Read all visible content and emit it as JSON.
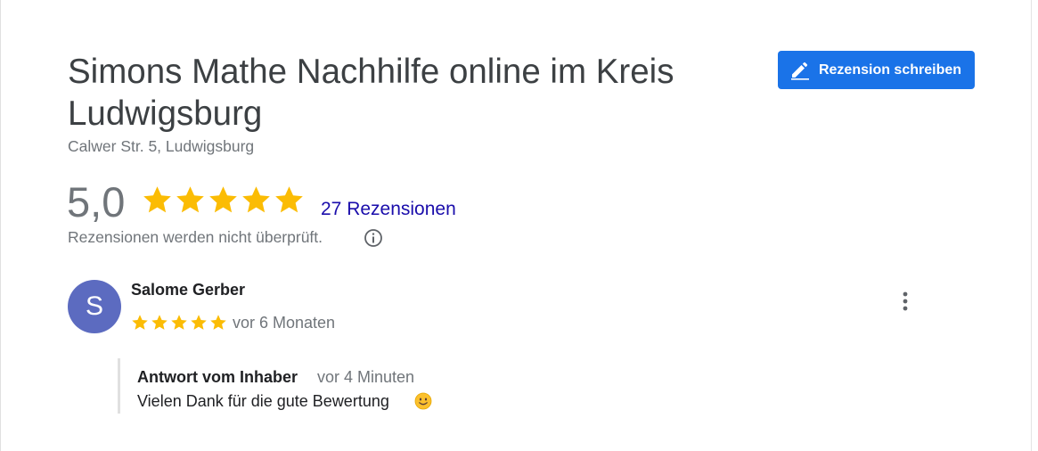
{
  "header": {
    "title": "Simons Mathe Nachhilfe online im Kreis Ludwigsburg",
    "address": "Calwer Str. 5, Ludwigsburg",
    "write_review_label": "Rezension schreiben"
  },
  "rating": {
    "value": "5,0",
    "stars": 5,
    "review_count_label": "27 Rezensionen",
    "disclaimer": "Rezensionen werden nicht überprüft."
  },
  "review": {
    "avatar_letter": "S",
    "author": "Salome Gerber",
    "stars": 5,
    "date": "vor 6 Monaten",
    "owner_reply": {
      "label": "Antwort vom Inhaber",
      "time": "vor 4 Minuten",
      "text": "Vielen Dank für die gute Bewertung"
    }
  },
  "icons": {
    "write": "pencil-icon",
    "info": "info-icon",
    "more": "more-vertical-icon",
    "emoji": "smiley-icon"
  },
  "colors": {
    "accent": "#1a73e8",
    "star": "#fbbc04",
    "link": "#1a0dab",
    "avatar": "#5c6bc0",
    "muted": "#70757a"
  }
}
